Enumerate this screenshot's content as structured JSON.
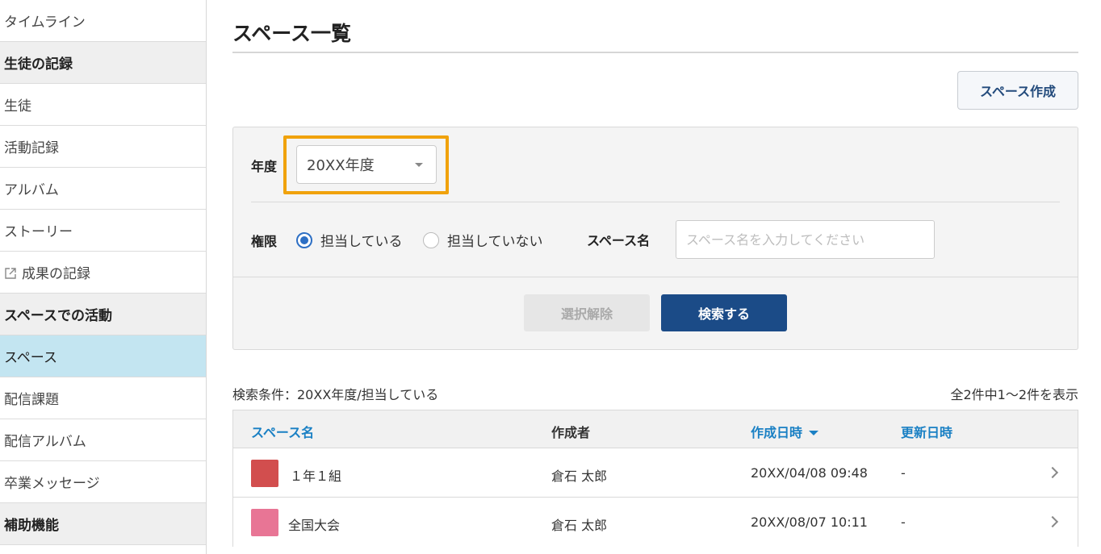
{
  "sidebar": {
    "items": [
      {
        "label": "タイムライン",
        "type": "item"
      },
      {
        "label": "生徒の記録",
        "type": "header"
      },
      {
        "label": "生徒",
        "type": "item"
      },
      {
        "label": "活動記録",
        "type": "item"
      },
      {
        "label": "アルバム",
        "type": "item"
      },
      {
        "label": "ストーリー",
        "type": "item"
      },
      {
        "label": "成果の記録",
        "type": "external"
      },
      {
        "label": "スペースでの活動",
        "type": "header"
      },
      {
        "label": "スペース",
        "type": "active"
      },
      {
        "label": "配信課題",
        "type": "item"
      },
      {
        "label": "配信アルバム",
        "type": "item"
      },
      {
        "label": "卒業メッセージ",
        "type": "item"
      },
      {
        "label": "補助機能",
        "type": "header"
      }
    ]
  },
  "page": {
    "title": "スペース一覧",
    "create_button": "スペース作成"
  },
  "search": {
    "year_label": "年度",
    "year_value": "20XX年度",
    "permission_label": "権限",
    "radio_assigned": "担当している",
    "radio_not_assigned": "担当していない",
    "selected_radio": "担当している",
    "space_name_label": "スペース名",
    "space_name_placeholder": "スペース名を入力してください",
    "space_name_value": "",
    "clear_button": "選択解除",
    "search_button": "検索する"
  },
  "results": {
    "condition": "検索条件：20XX年度/担当している",
    "count": "全2件中1～2件を表示",
    "columns": {
      "name": "スペース名",
      "author": "作成者",
      "created": "作成日時",
      "updated": "更新日時"
    },
    "rows": [
      {
        "color": "#d24e4e",
        "name": "１年１組",
        "author": "倉石 太郎",
        "created": "20XX/04/08 09:48",
        "updated": "-"
      },
      {
        "color": "#e87595",
        "name": "全国大会",
        "author": "倉石 太郎",
        "created": "20XX/08/07 10:11",
        "updated": "-"
      }
    ]
  }
}
